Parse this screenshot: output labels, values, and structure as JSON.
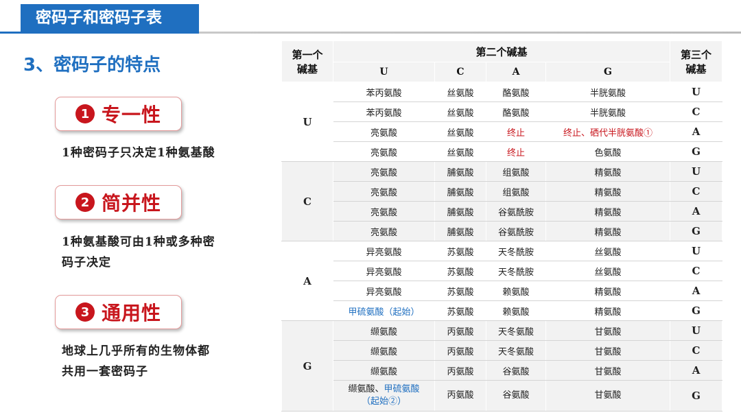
{
  "header": {
    "title": "密码子和密码子表"
  },
  "section": {
    "title": "3、密码子的特点"
  },
  "features": [
    {
      "number": "1",
      "label": "专一性",
      "description": "1种密码子只决定1种氨基酸"
    },
    {
      "number": "2",
      "label": "简并性",
      "description_line1": "1种氨基酸可由1种或多种密",
      "description_line2": "码子决定"
    },
    {
      "number": "3",
      "label": "通用性",
      "description_line1": "地球上几乎所有的生物体都",
      "description_line2": "共用一套密码子"
    }
  ],
  "table": {
    "header_first": "第一个碱基",
    "header_first_1": "第一个",
    "header_first_2": "碱基",
    "header_second": "第二个碱基",
    "header_third_1": "第三个",
    "header_third_2": "碱基",
    "sub_headers": [
      "U",
      "C",
      "A",
      "G"
    ],
    "groups": [
      {
        "base": "U",
        "rows": [
          {
            "cells": [
              "苯丙氨酸",
              "丝氨酸",
              "酪氨酸",
              "半胱氨酸"
            ],
            "third": "U"
          },
          {
            "cells": [
              "苯丙氨酸",
              "丝氨酸",
              "酪氨酸",
              "半胱氨酸"
            ],
            "third": "C"
          },
          {
            "cells": [
              "亮氨酸",
              "丝氨酸",
              "终止",
              "终止、硒代半胱氨酸①"
            ],
            "third": "A"
          },
          {
            "cells": [
              "亮氨酸",
              "丝氨酸",
              "终止",
              "色氨酸"
            ],
            "third": "G"
          }
        ]
      },
      {
        "base": "C",
        "rows": [
          {
            "cells": [
              "亮氨酸",
              "脯氨酸",
              "组氨酸",
              "精氨酸"
            ],
            "third": "U"
          },
          {
            "cells": [
              "亮氨酸",
              "脯氨酸",
              "组氨酸",
              "精氨酸"
            ],
            "third": "C"
          },
          {
            "cells": [
              "亮氨酸",
              "脯氨酸",
              "谷氨酰胺",
              "精氨酸"
            ],
            "third": "A"
          },
          {
            "cells": [
              "亮氨酸",
              "脯氨酸",
              "谷氨酰胺",
              "精氨酸"
            ],
            "third": "G"
          }
        ]
      },
      {
        "base": "A",
        "rows": [
          {
            "cells": [
              "异亮氨酸",
              "苏氨酸",
              "天冬酰胺",
              "丝氨酸"
            ],
            "third": "U"
          },
          {
            "cells": [
              "异亮氨酸",
              "苏氨酸",
              "天冬酰胺",
              "丝氨酸"
            ],
            "third": "C"
          },
          {
            "cells": [
              "异亮氨酸",
              "苏氨酸",
              "赖氨酸",
              "精氨酸"
            ],
            "third": "A"
          },
          {
            "cells": [
              "甲硫氨酸（起始）",
              "苏氨酸",
              "赖氨酸",
              "精氨酸"
            ],
            "third": "G"
          }
        ]
      },
      {
        "base": "G",
        "rows": [
          {
            "cells": [
              "缬氨酸",
              "丙氨酸",
              "天冬氨酸",
              "甘氨酸"
            ],
            "third": "U"
          },
          {
            "cells": [
              "缬氨酸",
              "丙氨酸",
              "天冬氨酸",
              "甘氨酸"
            ],
            "third": "C"
          },
          {
            "cells": [
              "缬氨酸",
              "丙氨酸",
              "谷氨酸",
              "甘氨酸"
            ],
            "third": "A"
          },
          {
            "cells_part1": "缬氨酸、",
            "cells_part2": "甲硫氨酸",
            "cells_part3": "（起始②）",
            "cells": [
              "",
              "丙氨酸",
              "谷氨酸",
              "甘氨酸"
            ],
            "third": "G"
          }
        ]
      }
    ]
  },
  "colors": {
    "brand_blue": "#1f6fc0",
    "accent_red": "#c8161d"
  }
}
